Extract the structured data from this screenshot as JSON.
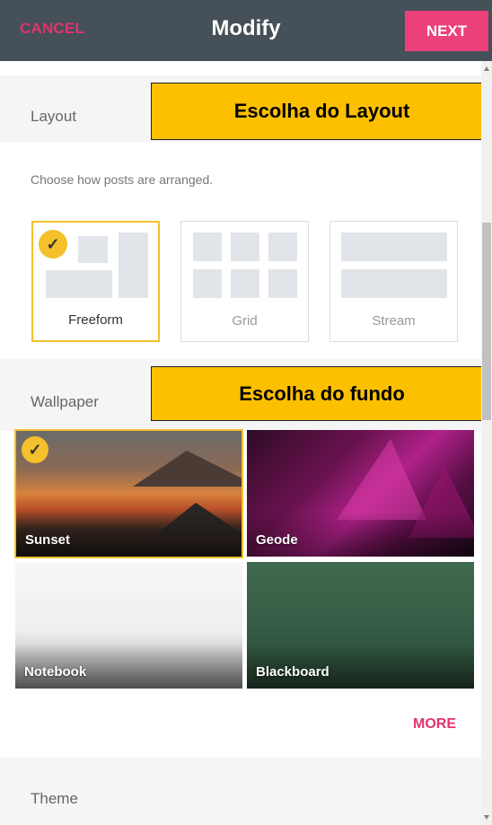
{
  "header": {
    "cancel_label": "CANCEL",
    "title": "Modify",
    "next_label": "NEXT"
  },
  "layout": {
    "section_label": "Layout",
    "description": "Choose how posts are arranged.",
    "options": [
      {
        "label": "Freeform",
        "selected": true
      },
      {
        "label": "Grid",
        "selected": false
      },
      {
        "label": "Stream",
        "selected": false
      }
    ],
    "callout": "Escolha do Layout"
  },
  "wallpaper": {
    "section_label": "Wallpaper",
    "callout": "Escolha do fundo",
    "options": [
      {
        "label": "Sunset",
        "selected": true
      },
      {
        "label": "Geode",
        "selected": false
      },
      {
        "label": "Notebook",
        "selected": false
      },
      {
        "label": "Blackboard",
        "selected": false
      }
    ],
    "more_label": "MORE"
  },
  "theme": {
    "section_label": "Theme"
  },
  "colors": {
    "topbar": "#455058",
    "accent_pink": "#ec407a",
    "cancel_pink": "#e2336d",
    "selected_yellow": "#f4c02b",
    "callout_yellow": "#fdc000"
  },
  "icons": {
    "check": "checkmark-icon",
    "scroll_up": "arrow-up-icon",
    "scroll_down": "arrow-down-icon"
  }
}
